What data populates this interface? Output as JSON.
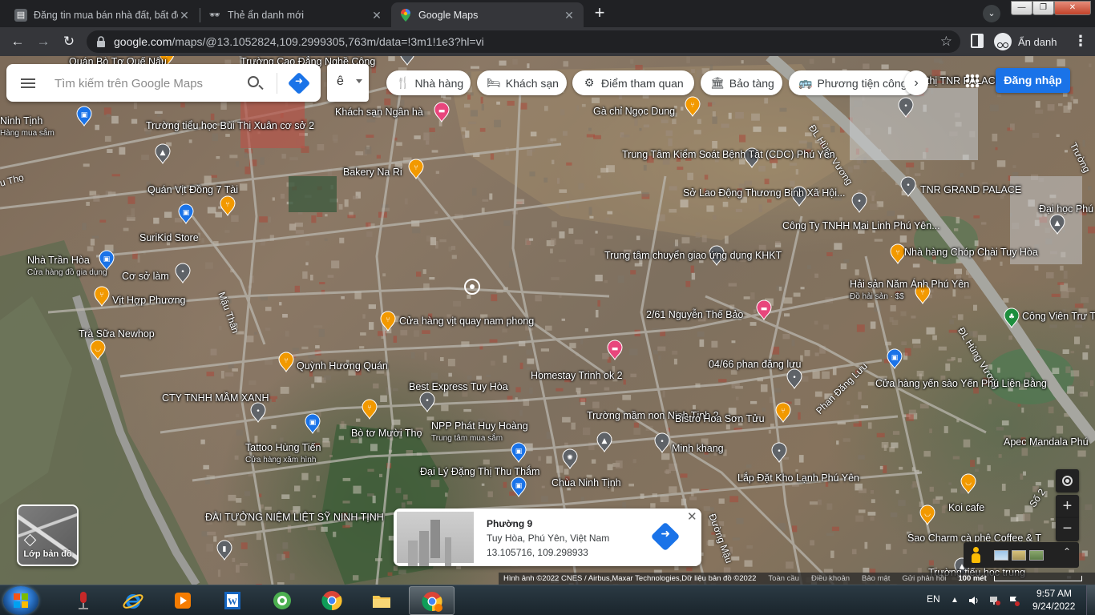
{
  "tabs": [
    {
      "title": "Đăng tin mua bán nhà đất, bất động sản",
      "close": "✕",
      "state": "inactive"
    },
    {
      "title": "Thẻ ẩn danh mới",
      "close": "✕",
      "state": "inactive"
    },
    {
      "title": "Google Maps",
      "close": "✕",
      "state": "active"
    }
  ],
  "new_tab_label": "+",
  "tab_search_label": "⌄",
  "window_controls": {
    "minimize": "—",
    "maximize": "❐",
    "close": "✕"
  },
  "toolbar": {
    "back": "←",
    "forward": "→",
    "reload": "↻",
    "url_host": "google.com",
    "url_path": "/maps/@13.1052824,109.2999305,763m/data=!3m1!1e3?hl=vi",
    "bookmark_star": "☆",
    "incognito_label": "Ẩn danh",
    "menu": "⋮"
  },
  "search": {
    "placeholder": "Tìm kiếm trên Google Maps"
  },
  "ime": {
    "char": "ê"
  },
  "chips": [
    {
      "label": "Nhà hàng",
      "icon": "fork-knife-icon",
      "glyph": "🍴"
    },
    {
      "label": "Khách sạn",
      "icon": "bed-icon",
      "glyph": "🛏"
    },
    {
      "label": "Điểm tham quan",
      "icon": "camera-icon",
      "glyph": "⚙"
    },
    {
      "label": "Bảo tàng",
      "icon": "museum-icon",
      "glyph": "🏛"
    },
    {
      "label": "Phương tiện công cộng",
      "icon": "bus-icon",
      "glyph": "🚌"
    }
  ],
  "chip_next": "›",
  "signin_label": "Đăng nhập",
  "layers_label": "Lớp bản đồ",
  "zoom": {
    "in": "+",
    "out": "−"
  },
  "expand_glyph": "⌃",
  "place_card": {
    "name": "Phường 9",
    "address": "Tuy Hòa, Phú Yên, Việt Nam",
    "coords": "13.105716, 109.298933",
    "close": "✕"
  },
  "attribution": {
    "imagery": "Hình ảnh ©2022 CNES / Airbus,Maxar Technologies,Dữ liệu bản đồ ©2022",
    "links": [
      "Toàn cầu",
      "Điều khoản",
      "Bảo mật",
      "Gửi phản hồi"
    ],
    "scale": "100 mét"
  },
  "road_labels": [
    {
      "text": "ĐL Hùng Vương"
    },
    {
      "text": "ĐL Hùng Vương"
    },
    {
      "text": "Mậu Thân"
    },
    {
      "text": "Phan Đăng Lưu"
    },
    {
      "text": "Đường Mậu"
    },
    {
      "text": "u Thọ"
    },
    {
      "text": "Trường"
    },
    {
      "text": "Số 2"
    }
  ],
  "pois": [
    {
      "label": "Quán Bò Tơ Quế Nậu",
      "sub": "",
      "pin": "restaurant",
      "color": "#f29900"
    },
    {
      "label": "Trường Cao Đẳng Nghề Công",
      "sub": "",
      "pin": "generic",
      "color": "#5f6368"
    },
    {
      "label": "Ninh Tịnh",
      "sub": "Hàng mua sắm",
      "pin": "shop",
      "color": "#1a73e8"
    },
    {
      "label": "Trường tiểu học Bùi Thị Xuân cơ sở 2",
      "sub": "",
      "pin": "school",
      "color": "#5f6368"
    },
    {
      "label": "Khách sạn Ngân hà",
      "sub": "",
      "pin": "hotel",
      "color": "#e8467c"
    },
    {
      "label": "Gà chỉ Ngọc Dung",
      "sub": "",
      "pin": "restaurant",
      "color": "#f29900"
    },
    {
      "label": "Trung Tâm Kiểm Soát Bệnh Tật (CDC) Phú Yên",
      "sub": "",
      "pin": "generic",
      "color": "#5f6368"
    },
    {
      "label": "Bakery Na Ri",
      "sub": "",
      "pin": "restaurant",
      "color": "#f29900"
    },
    {
      "label": "Quán Vịt Đồng 7 Tài",
      "sub": "",
      "pin": "restaurant",
      "color": "#f29900"
    },
    {
      "label": "Sở Lao Động Thương Binh Xã Hội...",
      "sub": "",
      "pin": "gov",
      "color": "#5f6368"
    },
    {
      "label": "TNR GRAND PALACE",
      "sub": "",
      "pin": "generic",
      "color": "#5f6368"
    },
    {
      "label": "Đại học Phú",
      "sub": "",
      "pin": "school",
      "color": "#5f6368"
    },
    {
      "label": "SuriKid Store",
      "sub": "",
      "pin": "shop",
      "color": "#1a73e8"
    },
    {
      "label": "Công Ty TNHH Mai Linh Phú Yên...",
      "sub": "",
      "pin": "generic",
      "color": "#5f6368"
    },
    {
      "label": "Nhà Trần Hòa",
      "sub": "Cửa hàng đồ gia dụng",
      "pin": "shop",
      "color": "#1a73e8"
    },
    {
      "label": "Cơ sở làm",
      "sub": "",
      "pin": "generic",
      "color": "#5f6368"
    },
    {
      "label": "Trung tâm chuyển giao ứng dụng KHKT",
      "sub": "",
      "pin": "gov",
      "color": "#5f6368"
    },
    {
      "label": "Nhà hàng Chóp Chài Tuy Hòa",
      "sub": "",
      "pin": "restaurant",
      "color": "#f29900"
    },
    {
      "label": "Vịt Hợp Phương",
      "sub": "",
      "pin": "restaurant",
      "color": "#f29900"
    },
    {
      "label": "Hải sản Năm Ánh Phú Yên",
      "sub": "Đồ hải sản · $$",
      "pin": "restaurant",
      "color": "#f29900"
    },
    {
      "label": "Trà Sữa Newhop",
      "sub": "",
      "pin": "cafe",
      "color": "#f29900"
    },
    {
      "label": "Cửa hàng vịt quay nam phong",
      "sub": "",
      "pin": "restaurant",
      "color": "#f29900"
    },
    {
      "label": "2/61 Nguyễn Thế Bảo",
      "sub": "",
      "pin": "hotel",
      "color": "#e8467c"
    },
    {
      "label": "Công Viên Trư Trường Đại Họ",
      "sub": "",
      "pin": "park",
      "color": "#1e8e3e"
    },
    {
      "label": "Quỳnh Hương Quán",
      "sub": "",
      "pin": "restaurant",
      "color": "#f29900"
    },
    {
      "label": "Homestay Trinh ok 2",
      "sub": "",
      "pin": "hotel",
      "color": "#e8467c"
    },
    {
      "label": "04/66 phan đăng lưu",
      "sub": "",
      "pin": "generic",
      "color": "#5f6368"
    },
    {
      "label": "Cửa hàng yến sào Yến Phú Liên Bằng",
      "sub": "",
      "pin": "shop",
      "color": "#1a73e8"
    },
    {
      "label": "CTY TNHH MẦM XANH",
      "sub": "",
      "pin": "generic",
      "color": "#5f6368"
    },
    {
      "label": "Best Express Tuy Hòa",
      "sub": "",
      "pin": "generic",
      "color": "#5f6368"
    },
    {
      "label": "Bò tơ Mười Thọ",
      "sub": "",
      "pin": "restaurant",
      "color": "#f29900"
    },
    {
      "label": "NPP Phát Huy Hoàng",
      "sub": "Trung tâm mua sắm",
      "pin": "shop",
      "color": "#1a73e8"
    },
    {
      "label": "Trường mầm non Ninh Tịnh 2",
      "sub": "",
      "pin": "school",
      "color": "#5f6368"
    },
    {
      "label": "Bistro Hoa Sơn Tửu",
      "sub": "",
      "pin": "restaurant",
      "color": "#f29900"
    },
    {
      "label": "Apec Mandala Phú",
      "sub": "",
      "pin": "generic",
      "color": "#5f6368"
    },
    {
      "label": "Tattoo Hùng Tiến",
      "sub": "Cửa hàng xăm hình",
      "pin": "shop",
      "color": "#1a73e8"
    },
    {
      "label": "Minh khang",
      "sub": "",
      "pin": "generic",
      "color": "#5f6368"
    },
    {
      "label": "Đại Lý Đặng Thị Thu Thắm",
      "sub": "",
      "pin": "shop",
      "color": "#1a73e8"
    },
    {
      "label": "Chùa Ninh Tịnh",
      "sub": "",
      "pin": "temple",
      "color": "#5f6368"
    },
    {
      "label": "Lắp Đặt Kho Lạnh Phú Yên",
      "sub": "",
      "pin": "generic",
      "color": "#5f6368"
    },
    {
      "label": "Koi cafe",
      "sub": "",
      "pin": "cafe",
      "color": "#f29900"
    },
    {
      "label": "ĐÀI TƯỞNG NIỆM LIỆT SỸ NINH TỊNH",
      "sub": "",
      "pin": "monument",
      "color": "#5f6368"
    },
    {
      "label": "Sao Charm cà phê Coffee & T",
      "sub": "",
      "pin": "cafe",
      "color": "#f29900"
    },
    {
      "label": "Trường tiểu học trung",
      "sub": "",
      "pin": "school",
      "color": "#5f6368"
    },
    {
      "label": "thị TNR PALACE",
      "sub": "",
      "pin": "generic",
      "color": "#5f6368"
    }
  ],
  "taskbar": {
    "apps": [
      {
        "name": "taskbar-app-recorder",
        "icon": "microphone-icon"
      },
      {
        "name": "taskbar-app-ie",
        "icon": "internet-explorer-icon"
      },
      {
        "name": "taskbar-app-media",
        "icon": "media-player-icon"
      },
      {
        "name": "taskbar-app-word",
        "icon": "word-icon"
      },
      {
        "name": "taskbar-app-coccoc",
        "icon": "coccoc-icon"
      },
      {
        "name": "taskbar-app-chrome",
        "icon": "chrome-icon"
      },
      {
        "name": "taskbar-app-explorer",
        "icon": "folder-icon"
      },
      {
        "name": "taskbar-app-chrome-incognito",
        "icon": "chrome-icon"
      }
    ],
    "lang": "EN",
    "time": "9:57 AM",
    "date": "9/24/2022"
  }
}
